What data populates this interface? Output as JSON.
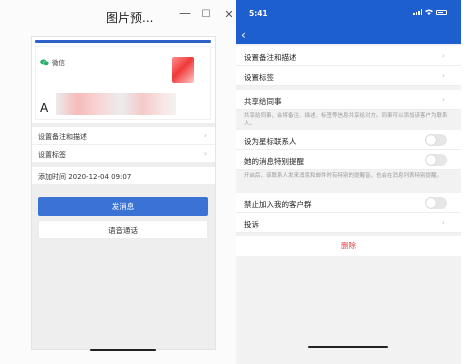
{
  "window": {
    "title": "图片预...",
    "minimize": "—",
    "maximize": "☐",
    "close": "✕"
  },
  "left_phone": {
    "card": {
      "app_label": "微信",
      "name_initial": "A"
    },
    "rows": [
      {
        "label": "设置备注和描述",
        "chevron": "›"
      },
      {
        "label": "设置标签",
        "chevron": "›"
      },
      {
        "label": "添加时间  2020-12-04 09:07",
        "chevron": ""
      }
    ],
    "send_button": "发消息",
    "voice_button": "语音通话"
  },
  "right_phone": {
    "time": "5:41",
    "back": "‹",
    "rows": {
      "remark": "设置备注和描述",
      "tags": "设置标签",
      "share": "共享给同事",
      "share_note": "共享给同事，会将备注、描述、标签等信息共享给对方。同事可以添加该客户为联系人。",
      "star": "设为星标联系人",
      "remind": "她的消息特别提醒",
      "remind_note": "开启后，该联系人发来消息和邮件时有特别的提醒音，也会在消息列表特别提醒。",
      "block": "禁止加入我的客户群",
      "report": "投诉",
      "chevron": "›"
    },
    "delete": "删除"
  },
  "colors": {
    "accent_blue": "#1d5fcf",
    "button_blue": "#3b73d4",
    "delete_red": "#e64340",
    "wechat_green": "#2aae67"
  }
}
